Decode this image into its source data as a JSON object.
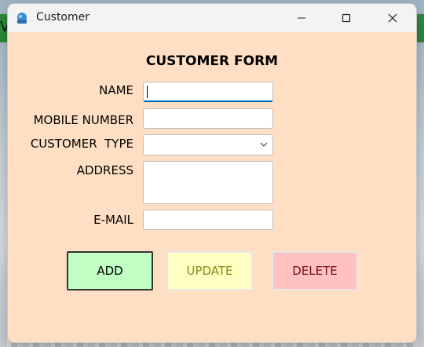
{
  "window": {
    "title": "Customer",
    "background_color": "#ffdfc4"
  },
  "background": {
    "partial_text": "Ve"
  },
  "form": {
    "heading": "CUSTOMER FORM",
    "fields": {
      "name": {
        "label": "NAME",
        "value": ""
      },
      "mobile": {
        "label": "MOBILE NUMBER",
        "value": ""
      },
      "customer_type": {
        "label": "CUSTOMER  TYPE",
        "selected": ""
      },
      "address": {
        "label": "ADDRESS",
        "value": ""
      },
      "email": {
        "label": "E-MAIL",
        "value": ""
      }
    }
  },
  "buttons": {
    "add": {
      "label": "ADD",
      "color": "#c1ffc4"
    },
    "update": {
      "label": "UPDATE",
      "color": "#ffffc1"
    },
    "delete": {
      "label": "DELETE",
      "color": "#ffc1c1"
    }
  },
  "icons": {
    "app": "app-icon",
    "minimize": "minimize-icon",
    "maximize": "maximize-icon",
    "close": "close-icon",
    "dropdown": "chevron-down-icon"
  }
}
